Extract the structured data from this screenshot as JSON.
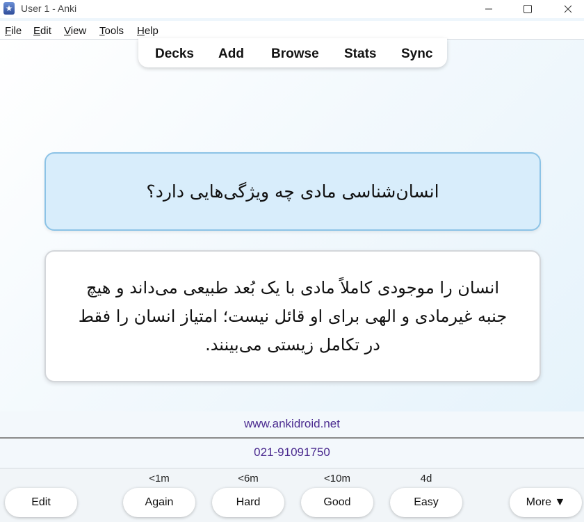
{
  "window": {
    "title": "User 1 - Anki",
    "app_icon": "anki-icon",
    "minimize": "—",
    "maximize": "☐",
    "close": "✕"
  },
  "menu": [
    {
      "first": "F",
      "rest": "ile"
    },
    {
      "first": "E",
      "rest": "dit"
    },
    {
      "first": "V",
      "rest": "iew"
    },
    {
      "first": "T",
      "rest": "ools"
    },
    {
      "first": "H",
      "rest": "elp"
    }
  ],
  "toolbar": {
    "items": [
      "Decks",
      "Add",
      "Browse",
      "Stats",
      "Sync"
    ]
  },
  "card": {
    "question": "انسان‌شناسی مادی چه ویژگی‌هایی دارد؟",
    "answer": "انسان را موجودی کاملاً مادی با یک بُعد طبیعی می‌داند و هیچ جنبه غیرمادی و الهی برای او قائل نیست؛ امتیاز انسان را فقط در تکامل زیستی می‌بینند."
  },
  "info": {
    "website": "www.ankidroid.net",
    "phone": "021-91091750"
  },
  "bottom": {
    "edit_label": "Edit",
    "more_label": "More ▼",
    "answers": [
      {
        "label": "Again",
        "interval": "<1m"
      },
      {
        "label": "Hard",
        "interval": "<6m"
      },
      {
        "label": "Good",
        "interval": "<10m"
      },
      {
        "label": "Easy",
        "interval": "4d"
      }
    ]
  }
}
